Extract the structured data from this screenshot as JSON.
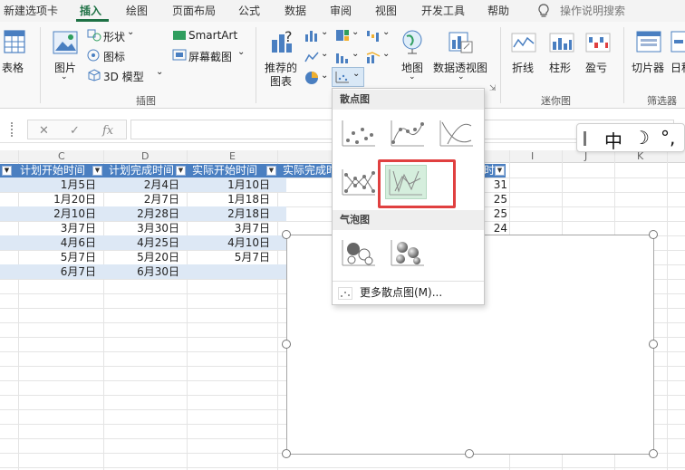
{
  "ribbon_tabs": [
    {
      "label": "新建选项卡"
    },
    {
      "label": "插入"
    },
    {
      "label": "绘图"
    },
    {
      "label": "页面布局"
    },
    {
      "label": "公式"
    },
    {
      "label": "数据"
    },
    {
      "label": "审阅"
    },
    {
      "label": "视图"
    },
    {
      "label": "开发工具"
    },
    {
      "label": "帮助"
    }
  ],
  "tell_me": "操作说明搜索",
  "ribbon": {
    "table": "表格",
    "picture": "图片",
    "shapes": "形状",
    "icons": "图标",
    "models3d": "3D 模型",
    "smartart": "SmartArt",
    "screenshot": "屏幕截图",
    "recommended_charts_line1": "推荐的",
    "recommended_charts_line2": "图表",
    "map": "地图",
    "pivot_chart": "数据透视图",
    "spark_line": "折线",
    "spark_column": "柱形",
    "spark_winloss": "盈亏",
    "slicer": "切片器",
    "timeline": "日程",
    "group_illustrations": "插图",
    "group_sparklines": "迷你图",
    "group_filters": "筛选器"
  },
  "formula_bar": {
    "cancel": "✕",
    "enter": "✓",
    "fx": "fx",
    "value": ""
  },
  "columns": [
    "C",
    "D",
    "E",
    "I",
    "J",
    "K"
  ],
  "table": {
    "headers": [
      "计划开始时间",
      "计划完成时间",
      "实际开始时间",
      "实际完成时"
    ],
    "rows": [
      [
        "1月5日",
        "2月4日",
        "1月10日"
      ],
      [
        "1月20日",
        "2月7日",
        "1月18日"
      ],
      [
        "2月10日",
        "2月28日",
        "2月18日"
      ],
      [
        "3月7日",
        "3月30日",
        "3月7日"
      ],
      [
        "4月6日",
        "4月25日",
        "4月10日"
      ],
      [
        "5月7日",
        "5月20日",
        "5月7日"
      ],
      [
        "6月7日",
        "6月30日",
        ""
      ]
    ],
    "right_header": "时",
    "right_values": [
      "31",
      "25",
      "25",
      "24"
    ]
  },
  "dropdown": {
    "scatter_header": "散点图",
    "bubble_header": "气泡图",
    "more": "更多散点图(M)..."
  },
  "ime": {
    "mode": "中",
    "moon": "☽",
    "punct": "°,"
  },
  "colors": {
    "accent": "#1e7145",
    "table_header": "#4a7fc1",
    "table_band": "#dde8f5",
    "highlight": "#e04040"
  }
}
